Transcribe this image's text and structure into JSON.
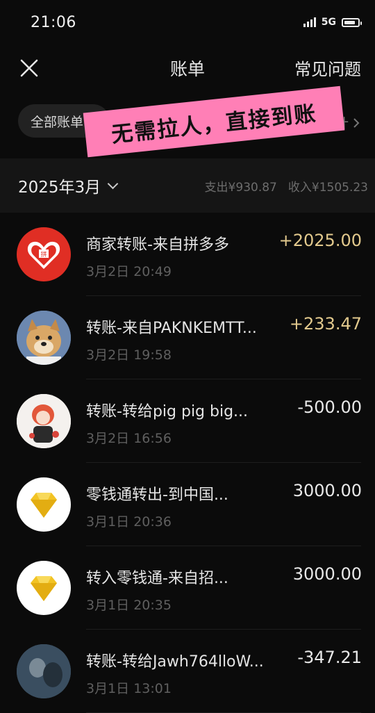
{
  "status_bar": {
    "time": "21:06",
    "network": "5G",
    "battery_level": 0.85
  },
  "nav": {
    "title": "账单",
    "faq": "常见问题"
  },
  "filter": {
    "label": "全部账单",
    "stats_label": "统计"
  },
  "promo": {
    "text": "无需拉人，直接到账"
  },
  "month": {
    "label": "2025年3月",
    "expense": "支出¥930.87",
    "income": "收入¥1505.23"
  },
  "transactions": [
    {
      "title": "商家转账-来自拼多多",
      "time": "3月2日 20:49",
      "amount": "+2025.00",
      "avatar": "pinduoduo-logo"
    },
    {
      "title": "转账-来自PAKNKEMTT...",
      "time": "3月2日 19:58",
      "amount": "+233.47",
      "avatar": "dog-avatar"
    },
    {
      "title": "转账-转给pig pig big...",
      "time": "3月2日 16:56",
      "amount": "-500.00",
      "avatar": "anime-girl-avatar"
    },
    {
      "title": "零钱通转出-到中国...",
      "time": "3月1日 20:36",
      "amount": "3000.00",
      "avatar": "diamond-icon"
    },
    {
      "title": "转入零钱通-来自招...",
      "time": "3月1日 20:35",
      "amount": "3000.00",
      "avatar": "diamond-icon"
    },
    {
      "title": "转账-转给Jawh764lloW...",
      "time": "3月1日 13:01",
      "amount": "-347.21",
      "avatar": "photo-avatar"
    }
  ],
  "colors": {
    "background": "#0b0b0b",
    "income": "#e2c98d",
    "promo": "#ff7fb6",
    "pdd_red": "#e02e24",
    "diamond": "#f2c324"
  }
}
